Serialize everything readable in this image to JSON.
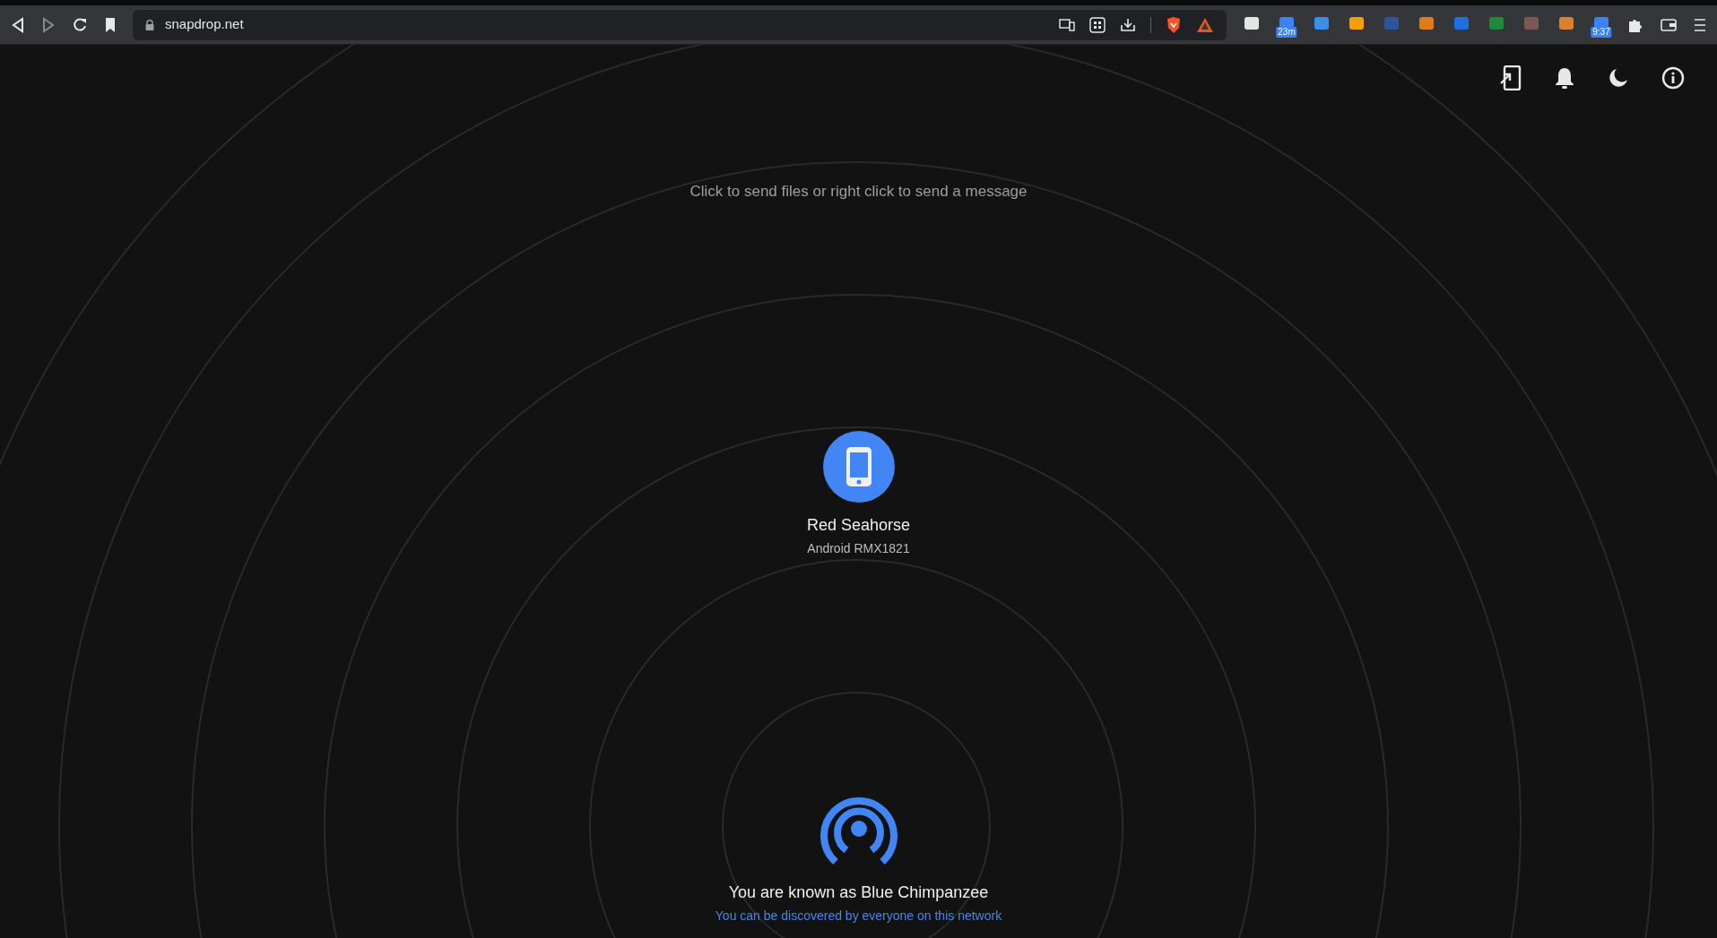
{
  "browser": {
    "address": "snapdrop.net",
    "extensions": [
      {
        "color": "#e5e5e5"
      },
      {
        "color": "#3b82f6",
        "badge": "23m"
      },
      {
        "color": "#3b8eea"
      },
      {
        "color": "#f59e0b"
      },
      {
        "color": "#2b579a"
      },
      {
        "color": "#e07b1a"
      },
      {
        "color": "#1e6fe0"
      },
      {
        "color": "#1f8a3b"
      },
      {
        "color": "#7a5a50"
      },
      {
        "color": "#d9822b"
      },
      {
        "color": "#3b82f6",
        "badge": "9:37"
      }
    ]
  },
  "hint": "Click to send files or right click to send a message",
  "peer": {
    "name": "Red Seahorse",
    "device": "Android RMX1821"
  },
  "self": {
    "title": "You are known as Blue Chimpanzee",
    "subtitle": "You can be discovered by everyone on this network"
  }
}
